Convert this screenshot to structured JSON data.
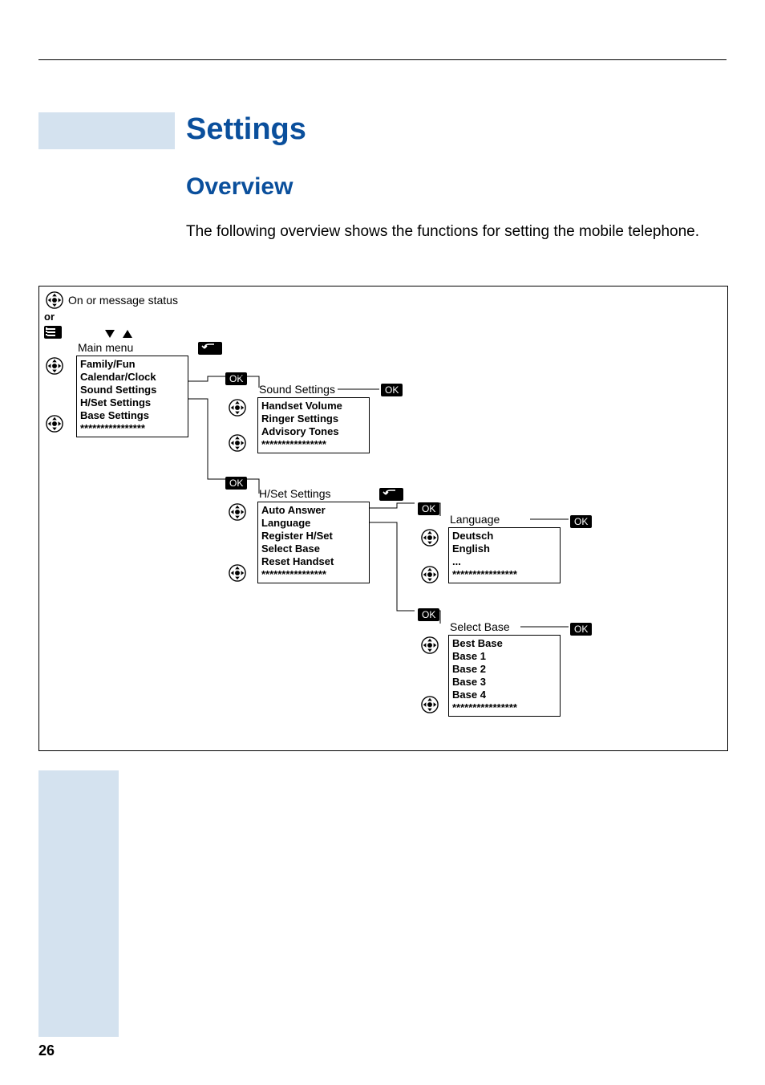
{
  "page": {
    "number": "26"
  },
  "headings": {
    "title": "Settings",
    "subtitle": "Overview",
    "intro": "The following overview shows the functions for setting the mobile telephone."
  },
  "labels": {
    "on_or_message": "On or message status",
    "or": "or",
    "main_menu": "Main menu",
    "sound_settings": "Sound Settings",
    "hset_settings": "H/Set Settings",
    "language": "Language",
    "select_base": "Select Base",
    "ok": "OK"
  },
  "menus": {
    "main": [
      "Family/Fun",
      "Calendar/Clock",
      "Sound Settings",
      "H/Set Settings",
      "Base Settings",
      "****************"
    ],
    "sound": [
      "Handset Volume",
      "Ringer Settings",
      "Advisory Tones",
      "****************"
    ],
    "hset": [
      "Auto Answer",
      "Language",
      "Register H/Set",
      "Select Base",
      "Reset Handset",
      "****************"
    ],
    "language": [
      "Deutsch",
      "English",
      "...",
      "****************"
    ],
    "selectbase": [
      "Best Base",
      "Base 1",
      "Base 2",
      "Base 3",
      "Base 4",
      "****************"
    ]
  }
}
